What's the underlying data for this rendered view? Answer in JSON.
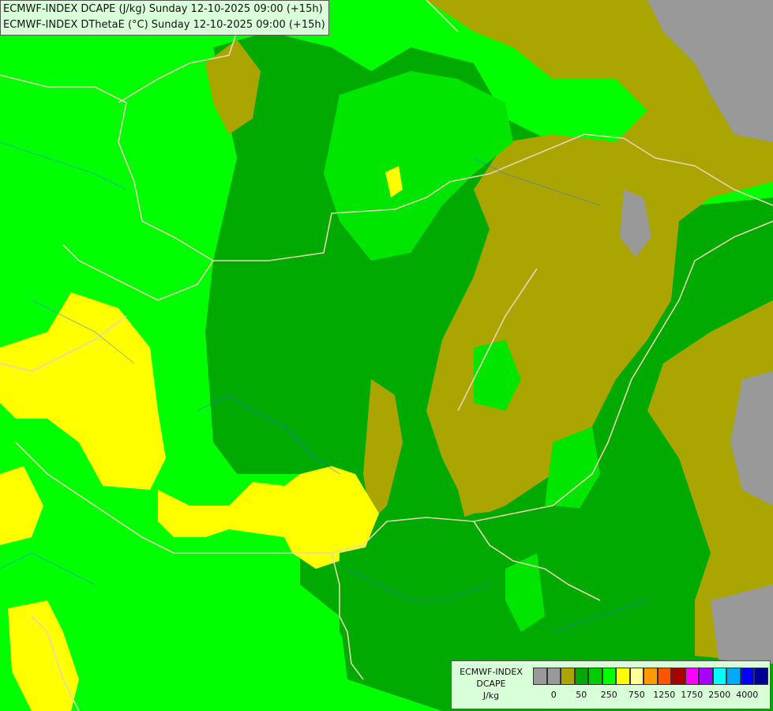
{
  "map": {
    "title_lines": [
      "ECMWF-INDEX DCAPE (J/kg) Sunday 12-10-2025 09:00 (+15h)",
      "ECMWF-INDEX DThetaE (°C) Sunday 12-10-2025 09:00 (+15h)"
    ],
    "field_colors": {
      "light_green": "#00ff00",
      "mid_green": "#00e600",
      "dark_green": "#00aa00",
      "olive": "#aaa500",
      "grey": "#999999",
      "yellow": "#ffff00",
      "border_line": "#e6d6b0",
      "river_line": "#2b6cff"
    }
  },
  "legend": {
    "header_lines": [
      "ECMWF-INDEX",
      "DCAPE",
      "J/kg"
    ],
    "colors": [
      "#999999",
      "#999999",
      "#aaa500",
      "#00aa00",
      "#00cc00",
      "#00ff00",
      "#ffff00",
      "#ffff99",
      "#ff9900",
      "#ff5500",
      "#aa0000",
      "#ff00ff",
      "#aa00ff",
      "#00ffff",
      "#00aaff",
      "#0000ff",
      "#000099"
    ],
    "tick_labels": [
      "0",
      "50",
      "250",
      "750",
      "1250",
      "1750",
      "2500",
      "4000"
    ]
  }
}
